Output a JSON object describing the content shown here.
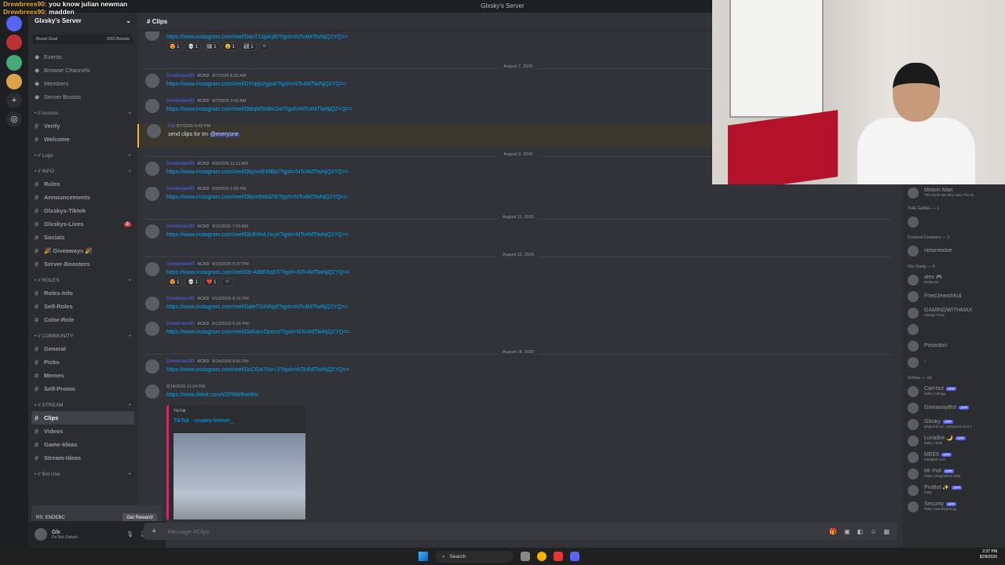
{
  "window_title": "Glxsky's Server",
  "overlay_chat": [
    {
      "user": "Drewbrees90:",
      "text": "you know julian newman"
    },
    {
      "user": "Drewbrees90:",
      "text": "madden"
    }
  ],
  "server": {
    "name": "Glxsky's Server",
    "boost_goal": "Boost Goal",
    "boost_count": "0/33 Boosts"
  },
  "nav": [
    "Events",
    "Browse Channels",
    "Members",
    "Server Boosts"
  ],
  "categories": {
    "access": "• // Access",
    "logs": "• // Logs",
    "info": "• // INFO",
    "roles": "• // ROLES",
    "community": "• // COMMUNITY",
    "stream": "• // STREAM",
    "botuse": "• // Bot Use"
  },
  "channels": {
    "access": [
      "Verify",
      "Welcome"
    ],
    "info": [
      "Rules",
      "Announcements",
      "Glxskys-Tiktok",
      "Glxskys-Lives",
      "Socials",
      "🎉 Giveaways 🎉",
      "Server-Boosters"
    ],
    "info_badge": "2",
    "roles": [
      "Roles-Info",
      "Self-Roles",
      "Color-Role"
    ],
    "community": [
      "General",
      "Picks",
      "Memes",
      "Self-Promo"
    ],
    "stream": [
      "Clips",
      "Videos",
      "Game-Ideas",
      "Stream-Ideas"
    ]
  },
  "reward": {
    "text": "RS: ENDEBC",
    "button": "Get Reward!"
  },
  "user": {
    "name": "Glx",
    "status": "Do Not Disturb"
  },
  "channel": {
    "name": "Clips",
    "placeholder": "Message #Clips"
  },
  "messages": [
    {
      "ts": "8/7/2026 ...",
      "link": "https://www.instagram.com/reel/DanT1SjxKjR/?igsh=NTc4MTlwNjQ2YQ==",
      "reactions": [
        "😍 1",
        "💀 1",
        "🖼 1",
        "😮 1",
        "🏞 1"
      ]
    },
    {
      "divider": "August 7, 2026"
    },
    {
      "author": "Drewbrees90",
      "tag": "KCKD",
      "ts": "8/7/2026 8:22 AM",
      "link": "https://www.instagram.com/reel/DYnpjo2gjo9/?igsh=NTc4MTlwNjQ2YQ=="
    },
    {
      "author": "Drewbrees90",
      "tag": "KCKD",
      "ts": "8/7/2026 3:42 AM",
      "link": "https://www.instagram.com/reel/DbtqW5nBKOe/?igsh=NTc4MTlwNjQ2YQ=="
    },
    {
      "author": "Glx",
      "ts": "8/7/2026 9:42 PM",
      "text": "send clips for tm",
      "mention": "@everyone"
    },
    {
      "divider": "August 9, 2026"
    },
    {
      "author": "Drewbrees90",
      "tag": "KCKD",
      "ts": "8/9/2026 11:13 AM",
      "link": "https://www.instagram.com/reel/Dbynx6hMBlc/?igsh=NTc4MTlwNjQ2YQ=="
    },
    {
      "author": "Drewbrees90",
      "tag": "KCKD",
      "ts": "8/9/2026 1:59 PM",
      "link": "https://www.instagram.com/reel/Dbym6MsiZ9/?igsh=NTc4MTlwNjQ2YQ=="
    },
    {
      "divider": "August 11, 2026"
    },
    {
      "author": "Drewbrees90",
      "tag": "KCKD",
      "ts": "8/11/2026 7:20 AM",
      "link": "https://www.instagram.com/reel/Db3h5wLNcyi/?igsh=NTc4MTlwNjQ2YQ=="
    },
    {
      "divider": "August 13, 2026"
    },
    {
      "author": "Drewbrees90",
      "tag": "KCKD",
      "ts": "8/13/2026 5:37 PM",
      "link": "https://www.instagram.com/reel/Db-A98FEq57/?igsh=NTc4MTlwNjQ2YQ==",
      "reactions": [
        "😍 1",
        "💀 1",
        "❤️ 1"
      ]
    },
    {
      "author": "Drewbrees90",
      "tag": "KCKD",
      "ts": "8/13/2026 8:15 PM",
      "link": "https://www.instagram.com/reel/DaleTGtNNpf/?igsh=NTc4MTlwNjQ2YQ=="
    },
    {
      "author": "Drewbrees90",
      "tag": "KCKD",
      "ts": "8/13/2026 9:24 PM",
      "link": "https://www.instagram.com/reel/Db6uknOpocx/?igsh=NTc4MTlwNjQ2YQ=="
    },
    {
      "divider": "August 14, 2026"
    },
    {
      "author": "Drewbrees90",
      "tag": "KCKD",
      "ts": "8/14/2026 8:41 PM",
      "link": "https://www.instagram.com/reel/DcCGA70vi-U/?igsh=NTc4MTlwNjQ2YQ=="
    },
    {
      "ts": "8/14/2026 11:24 PM",
      "link": "https://www.tiktok.com/t/ZP8W8veWx/",
      "embed_provider": "TikTok",
      "embed_title": "TikTok · rosales.forever_"
    }
  ],
  "members": {
    "top": {
      "name": "Motion Man",
      "status": "This Ends We Who Saw The Di..."
    },
    "groups": [
      {
        "label": "THE GANG — 1",
        "items": [
          {
            "name": ""
          }
        ]
      },
      {
        "label": "Content Creators — 1",
        "items": [
          {
            "name": "notanewbie"
          }
        ]
      },
      {
        "label": "Glx Gang — 6",
        "items": [
          {
            "name": "alex 🎮",
            "status": "ROBLOX"
          },
          {
            "name": "FriedJewishKid"
          },
          {
            "name": "GAMINGWITHMAX",
            "status": "Always Tired"
          },
          {
            "name": ""
          },
          {
            "name": "Poseidon"
          },
          {
            "name": "-"
          }
        ]
      },
      {
        "label": "Online — 13",
        "items": [
          {
            "name": "Carl-bot",
            "bot": "APP",
            "status": "/help | carl.gg"
          },
          {
            "name": "GiveawayBot",
            "bot": "APP"
          },
          {
            "name": "Glxsky",
            "bot": "APP",
            "status": "pingcord.xyz | !pingcord v2.0.1"
          },
          {
            "name": "LunaBot 🌙",
            "bot": "APP",
            "status": "/help | /help"
          },
          {
            "name": "MEE6",
            "bot": "APP",
            "status": "mee6bot.com"
          },
          {
            "name": "Mr Poll",
            "bot": "APP",
            "status": "/help | Dragonfruit Start"
          },
          {
            "name": "ProBot ✨",
            "bot": "APP",
            "status": "/help"
          },
          {
            "name": "Security",
            "bot": "APP",
            "status": "/help | securitybot.gg"
          }
        ]
      }
    ]
  },
  "taskbar": {
    "search": "Search",
    "time": "2:37 PM",
    "date": "8/28/2026"
  }
}
